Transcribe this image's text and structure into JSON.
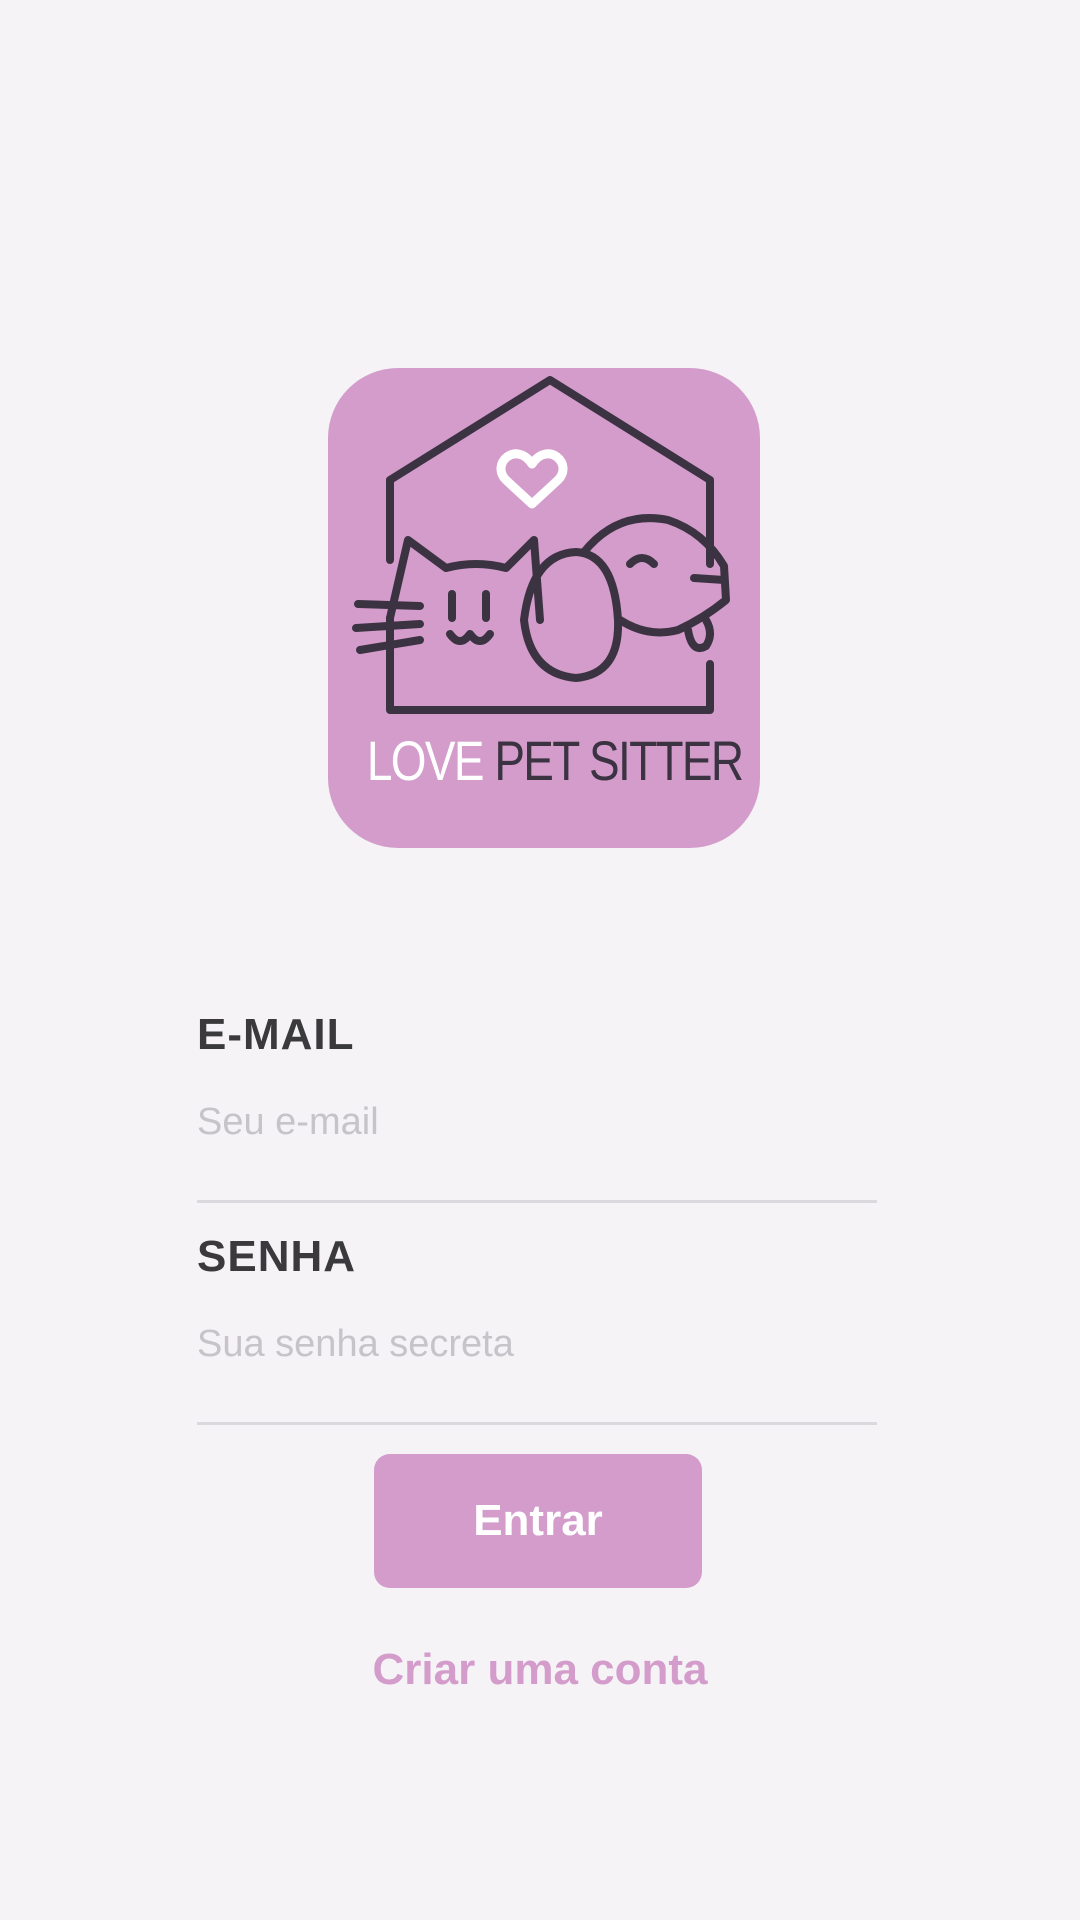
{
  "app": {
    "name": "Love Pet Sitter"
  },
  "logo": {
    "word1": "LOVE",
    "word2": "PET SITTER",
    "icon": "house-cat-dog-heart-icon",
    "background": "#d39ccb",
    "line_color": "#3c3342"
  },
  "form": {
    "email": {
      "label": "E-MAIL",
      "placeholder": "Seu e-mail",
      "value": ""
    },
    "password": {
      "label": "SENHA",
      "placeholder": "Sua senha secreta",
      "value": ""
    }
  },
  "actions": {
    "login_label": "Entrar",
    "signup_label": "Criar uma conta"
  },
  "colors": {
    "accent": "#d39ccb",
    "background": "#f6f3f7",
    "label_text": "#3a3a3c",
    "placeholder_text": "#c6c3c9"
  }
}
